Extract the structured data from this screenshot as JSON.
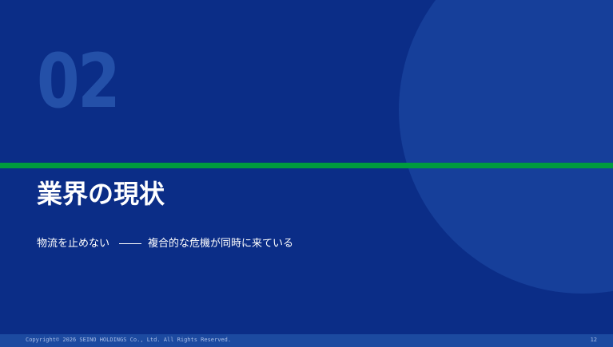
{
  "slide": {
    "section_number": "02",
    "title": "業界の現状",
    "subtitle_left": "物流を止めない",
    "subtitle_right": "複合的な危機が同時に来ている"
  },
  "footer": {
    "copyright": "Copyright© 2026  SEINO HOLDINGS Co., Ltd.  All Rights Reserved.",
    "page_number": "12"
  },
  "colors": {
    "background": "#0b2d87",
    "circle": "#163f9a",
    "section_number": "#2450a8",
    "accent_green": "#009b3e",
    "footer_bar": "#1c4aa0",
    "text": "#ffffff"
  }
}
